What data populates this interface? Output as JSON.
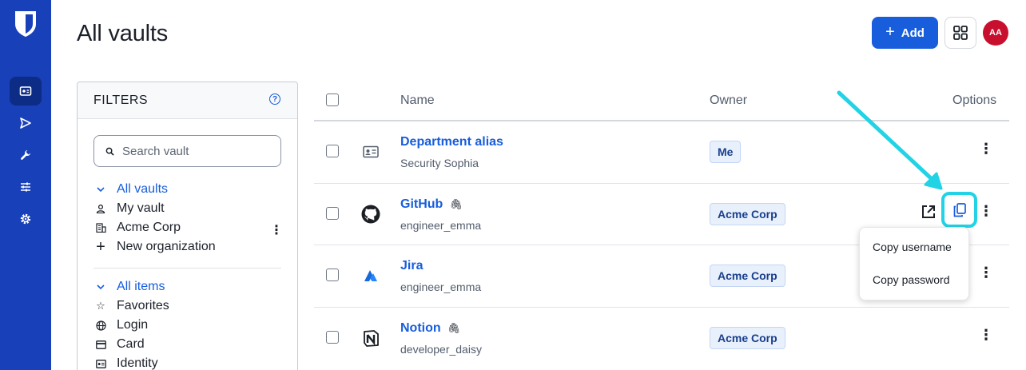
{
  "app": {
    "page_title": "All vaults",
    "accent": "#175ddc",
    "sidebar_color": "#1740b9"
  },
  "header": {
    "add_label": "Add",
    "add_icon": "plus-icon",
    "apps_icon": "grid-icon",
    "avatar_initials": "AA",
    "avatar_color": "#c8102e"
  },
  "sidebar": {
    "logo": "shield-logo",
    "items": [
      {
        "icon": "vault-icon",
        "active": true
      },
      {
        "icon": "send-icon",
        "active": false
      },
      {
        "icon": "wrench-icon",
        "active": false
      },
      {
        "icon": "sliders-icon",
        "active": false
      },
      {
        "icon": "gear-icon",
        "active": false
      }
    ]
  },
  "filters": {
    "title": "FILTERS",
    "help_icon": "question-icon",
    "search_placeholder": "Search vault",
    "vaults": {
      "heading": "All vaults",
      "items": [
        "My vault",
        "Acme Corp",
        "New organization"
      ]
    },
    "types": {
      "heading": "All items",
      "items": [
        "Favorites",
        "Login",
        "Card",
        "Identity"
      ]
    }
  },
  "table": {
    "columns": {
      "name": "Name",
      "owner": "Owner",
      "options": "Options"
    },
    "rows": [
      {
        "name": "Department alias",
        "subtitle": "Security Sophia",
        "owner": "Me",
        "icon": "id-card-icon",
        "attachment": false
      },
      {
        "name": "GitHub",
        "subtitle": "engineer_emma",
        "owner": "Acme Corp",
        "icon": "github-icon",
        "attachment": true
      },
      {
        "name": "Jira",
        "subtitle": "engineer_emma",
        "owner": "Acme Corp",
        "icon": "jira-icon",
        "attachment": false
      },
      {
        "name": "Notion",
        "subtitle": "developer_daisy",
        "owner": "Acme Corp",
        "icon": "notion-icon",
        "attachment": true
      }
    ]
  },
  "copy_menu": {
    "items": [
      "Copy username",
      "Copy password"
    ]
  },
  "annotation": {
    "color": "#22d3e6"
  }
}
